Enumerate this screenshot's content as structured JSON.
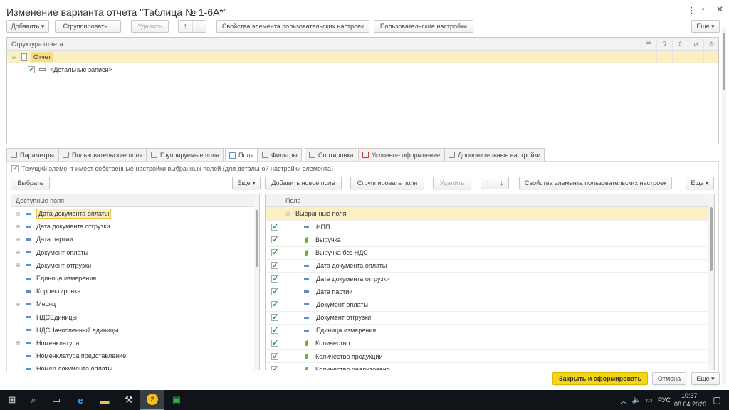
{
  "window": {
    "title": "Изменение варианта отчета \"Таблица № 1-6А*\"",
    "menu_icon": "more-vert-icon",
    "restore_icon": "restore-icon",
    "close_icon": "close-icon"
  },
  "toolbar": {
    "add": "Добавить",
    "group": "Сгруппировать...",
    "delete": "Удалить",
    "props": "Свойства элемента пользовательских настроек",
    "user_settings": "Пользовательские настройки",
    "more": "Еще"
  },
  "structure": {
    "header": "Структура отчета",
    "root": "Отчет",
    "detail": "<Детальные записи>",
    "detail_checked": true
  },
  "tabs": [
    {
      "label": "Параметры",
      "icon": "parameters-icon"
    },
    {
      "label": "Пользовательские поля",
      "icon": "user-fields-icon"
    },
    {
      "label": "Группируемые поля",
      "icon": "grouping-fields-icon"
    },
    {
      "label": "Поля",
      "icon": "fields-icon",
      "active": true
    },
    {
      "label": "Фильтры",
      "icon": "filter-icon"
    },
    {
      "label": "Сортировка",
      "icon": "sort-icon"
    },
    {
      "label": "Условное оформление",
      "icon": "conditional-format-icon"
    },
    {
      "label": "Дополнительные настройки",
      "icon": "additional-settings-icon"
    }
  ],
  "fields": {
    "own_settings_label": "Текущий элемент имеет собственные настройки выбранных полей (для детальной настройки элемента)",
    "own_settings_checked": true,
    "select": "Выбрать",
    "more_left": "Еще",
    "add_new": "Добавить новое поле",
    "group_fields": "Сгруппировать поля",
    "delete": "Удалить",
    "props": "Свойства элемента пользовательских настроек",
    "more_right": "Еще",
    "available_header": "Доступные поля",
    "available": [
      {
        "label": "Дата документа оплаты",
        "expandable": true,
        "selected": true
      },
      {
        "label": "Дата документа отгрузки",
        "expandable": true
      },
      {
        "label": "Дата партии",
        "expandable": true
      },
      {
        "label": "Документ оплаты",
        "expandable": true
      },
      {
        "label": "Документ отгрузки",
        "expandable": true
      },
      {
        "label": "Единица измерения",
        "expandable": false
      },
      {
        "label": "Корректировка",
        "expandable": false
      },
      {
        "label": "Месяц",
        "expandable": true
      },
      {
        "label": "НДСЕдиницы",
        "expandable": false
      },
      {
        "label": "НДСНачисленный единицы",
        "expandable": false
      },
      {
        "label": "Номенклатура",
        "expandable": true
      },
      {
        "label": "Номенклатура представление",
        "expandable": false
      },
      {
        "label": "Номер документа оплаты",
        "expandable": false
      }
    ],
    "selected_header": "Поле",
    "selected_group": "Выбранные поля",
    "selected": [
      {
        "label": "НПП",
        "type": "dimension"
      },
      {
        "label": "Выручка",
        "type": "resource"
      },
      {
        "label": "Выручка без НДС",
        "type": "resource"
      },
      {
        "label": "Дата документа оплаты",
        "type": "dimension"
      },
      {
        "label": "Дата документа отгрузки",
        "type": "dimension"
      },
      {
        "label": "Дата партии",
        "type": "dimension"
      },
      {
        "label": "Документ оплаты",
        "type": "dimension"
      },
      {
        "label": "Документ отгрузки",
        "type": "dimension"
      },
      {
        "label": "Единица измерения",
        "type": "dimension"
      },
      {
        "label": "Количество",
        "type": "resource"
      },
      {
        "label": "Количество продукции",
        "type": "resource"
      },
      {
        "label": "Количество реализовано",
        "type": "resource"
      }
    ]
  },
  "footer": {
    "submit": "Закрыть и сформировать",
    "cancel": "Отмена",
    "more": "Еще"
  },
  "taskbar": {
    "lang": "РУС",
    "time": "10:37",
    "date": "08.04.2026",
    "notification_badge": "2"
  },
  "colors": {
    "accent_yellow": "#f5d516",
    "highlight_row": "#fbefc4",
    "check_green": "#1ea03a",
    "arrow_blue": "#3a7fd0"
  }
}
